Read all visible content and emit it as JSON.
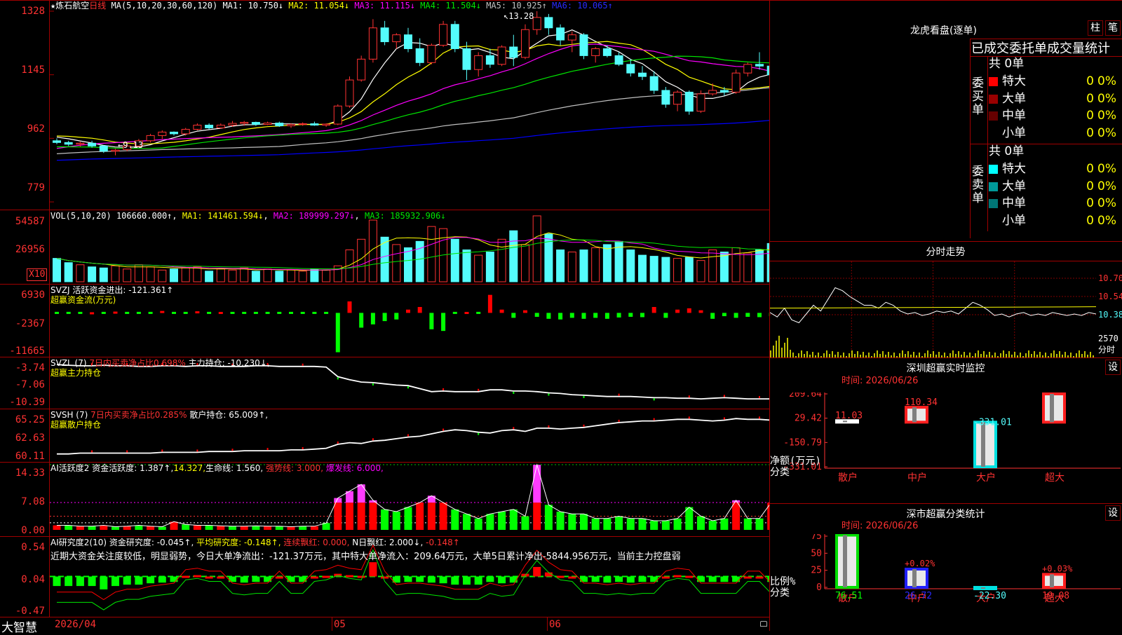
{
  "stock": {
    "star": "★",
    "name": "炼石航空",
    "period": "日线",
    "bottom_brand": "大智慧",
    "date_start": "2026/04",
    "month_05": "05",
    "month_06": "06"
  },
  "main_chart": {
    "axis_ticks": [
      "1328",
      "1145",
      "962",
      "779"
    ],
    "ma_legend": {
      "prefix": "MA(5,10,20,30,60,120)",
      "ma1": "MA1: 10.750↓",
      "ma2": "MA2: 11.054↓",
      "ma3": "MA3: 11.115↓",
      "ma4": "MA4: 11.504↓",
      "ma5": "MA5: 10.925↑",
      "ma6": "MA6: 10.065↑"
    },
    "high_label": "13.28",
    "low_label": "9.13",
    "colors": {
      "up": "#ff3232",
      "down": "#54fcfc",
      "ma1": "#ffffff",
      "ma2": "#ffff00",
      "ma3": "#ff00ff",
      "ma4": "#00e600",
      "ma5": "#c0c0c0",
      "ma6": "#0000ff"
    }
  },
  "vol_panel": {
    "axis_ticks": [
      "54587",
      "26956"
    ],
    "unit_label": "X10",
    "legend": {
      "prefix": "VOL(5,10,20)",
      "value": "106660.000↑",
      "ma1": "MA1: 141461.594↓",
      "ma2": "MA2: 189999.297↓",
      "ma3": "MA3: 185932.906↓"
    }
  },
  "svzj_panel": {
    "axis_ticks": [
      "6930",
      "-2367",
      "-11665"
    ],
    "legend_line1": "SVZJ  活跃资金进出: -121.361↑",
    "legend_line2": "超赢资金流(万元)"
  },
  "svzl_panel": {
    "axis_ticks": [
      "-3.74",
      "-7.06",
      "-10.39"
    ],
    "legend_a": "SVZL (7)",
    "legend_b": "7日内买卖净占比0.698%",
    "legend_c": "主力持仓: -10.230↓,",
    "legend_line2": "超赢主力持仓"
  },
  "svsh_panel": {
    "axis_ticks": [
      "65.25",
      "62.63",
      "60.11"
    ],
    "legend_a": "SVSH (7)",
    "legend_b": "7日内买卖净占比0.285%",
    "legend_c": "散户持仓: 65.009↑,",
    "legend_line2": "超赢散户持仓"
  },
  "ai_active_panel": {
    "axis_ticks": [
      "14.33",
      "7.08",
      "0.00"
    ],
    "legend_a": "AI活跃度2",
    "legend_b": "资金活跃度: 1.387↑,",
    "legend_c": "14.327,",
    "legend_d": "生命线: 1.560,",
    "legend_e": "强势线: 3.000,",
    "legend_f": "爆发线: 6.000,"
  },
  "ai_research_panel": {
    "axis_ticks": [
      "0.54",
      "0.04",
      "-0.47"
    ],
    "legend_a": "AI研究度2(10)",
    "legend_b": "资金研究度: -0.045↑,",
    "legend_c": "平均研究度: -0.148↑,",
    "legend_d": "连续飘红: 0.000,",
    "legend_e": "N日飘红: 2.000↓,",
    "legend_f": "-0.148↑",
    "comment": "近期大资金关注度较低，明显弱势，今日大单净流出：-121.37万元，其中特大单净流入：209.64万元，大单5日累计净出-5844.956万元，当前主力控盘弱"
  },
  "dragon_panel": {
    "title": "龙虎看盘(逐单)",
    "btn1": "柱",
    "btn2": "笔",
    "header": "已成交委托单成交量统计",
    "buy_side": "委买单",
    "sell_side": "委卖单",
    "buy_total": "共 0单",
    "sell_total": "共 0单",
    "buy_rows": [
      {
        "label": "特大",
        "value": "0",
        "pct": "0%",
        "color": "#ff0000"
      },
      {
        "label": "大单",
        "value": "0",
        "pct": "0%",
        "color": "#990000"
      },
      {
        "label": "中单",
        "value": "0",
        "pct": "0%",
        "color": "#660000"
      },
      {
        "label": "小单",
        "value": "0",
        "pct": "0%",
        "color": ""
      }
    ],
    "sell_rows": [
      {
        "label": "特大",
        "value": "0",
        "pct": "0%",
        "color": "#00ffff"
      },
      {
        "label": "大单",
        "value": "0",
        "pct": "0%",
        "color": "#009999"
      },
      {
        "label": "中单",
        "value": "0",
        "pct": "0%",
        "color": "#007777"
      },
      {
        "label": "小单",
        "value": "0",
        "pct": "0%",
        "color": ""
      }
    ]
  },
  "intraday": {
    "title": "分时走势",
    "axis_ticks": [
      "10.70",
      "10.54",
      "10.38",
      "2570"
    ],
    "corner_label": "分时"
  },
  "sz_monitor": {
    "title": "深圳超赢实时监控",
    "btn": "设",
    "time": "时间: 2026/06/26",
    "axis_ticks": [
      "209.64",
      "29.42",
      "-150.79",
      "-331.01"
    ],
    "y_title": "净额(万元)",
    "x_title": "分类",
    "bars": [
      {
        "cat": "散户",
        "value": 11.03,
        "label": "11.03"
      },
      {
        "cat": "中户",
        "value": 110.34,
        "label": "110.34"
      },
      {
        "cat": "大户",
        "value": -331.01,
        "label": "-331.01"
      },
      {
        "cat": "超大",
        "value": 209.64,
        "label": "209.64"
      }
    ]
  },
  "sz_stats": {
    "title": "深市超赢分类统计",
    "btn": "设",
    "time": "时间: 2026/06/26",
    "axis_ticks": [
      "75",
      "50",
      "25",
      "0"
    ],
    "y_title": "比例%",
    "x_title": "分类",
    "bars": [
      {
        "cat": "散户",
        "value": 76.51,
        "label": "76.51",
        "delta": "+0.00%"
      },
      {
        "cat": "中户",
        "value": 26.72,
        "label": "26.72",
        "delta": "+0.02%"
      },
      {
        "cat": "大户",
        "value": -22.3,
        "label": "-22.30",
        "delta": ""
      },
      {
        "cat": "超大",
        "value": 19.08,
        "label": "19.08",
        "delta": "+0.03%"
      }
    ]
  },
  "chart_data": [
    {
      "type": "candlestick",
      "title": "炼石航空 日线",
      "ylim": [
        7.79,
        13.28
      ],
      "ohlc": [
        [
          9.55,
          9.62,
          9.45,
          9.5
        ],
        [
          9.5,
          9.55,
          9.4,
          9.45
        ],
        [
          9.45,
          9.52,
          9.38,
          9.48
        ],
        [
          9.48,
          9.55,
          9.35,
          9.4
        ],
        [
          9.4,
          9.42,
          9.2,
          9.25
        ],
        [
          9.25,
          9.32,
          9.13,
          9.28
        ],
        [
          9.3,
          9.45,
          9.25,
          9.4
        ],
        [
          9.4,
          9.6,
          9.38,
          9.55
        ],
        [
          9.55,
          9.75,
          9.5,
          9.7
        ],
        [
          9.7,
          9.85,
          9.6,
          9.8
        ],
        [
          9.8,
          9.82,
          9.7,
          9.75
        ],
        [
          9.75,
          9.92,
          9.7,
          9.88
        ],
        [
          9.88,
          10.05,
          9.85,
          10.0
        ],
        [
          10.0,
          10.05,
          9.88,
          9.92
        ],
        [
          9.92,
          10.05,
          9.9,
          10.0
        ],
        [
          10.0,
          10.12,
          9.95,
          10.05
        ],
        [
          10.05,
          10.12,
          9.98,
          10.08
        ],
        [
          10.08,
          10.1,
          9.98,
          10.02
        ],
        [
          10.02,
          10.1,
          10.0,
          10.06
        ],
        [
          10.06,
          10.1,
          9.95,
          9.98
        ],
        [
          9.98,
          10.05,
          9.92,
          10.02
        ],
        [
          10.02,
          10.08,
          9.98,
          10.04
        ],
        [
          10.04,
          10.1,
          9.98,
          10.0
        ],
        [
          10.0,
          10.05,
          9.95,
          10.03
        ],
        [
          10.03,
          10.6,
          10.0,
          10.55
        ],
        [
          10.55,
          11.4,
          10.5,
          11.3
        ],
        [
          11.3,
          12.0,
          11.25,
          11.9
        ],
        [
          11.9,
          13.05,
          11.8,
          12.8
        ],
        [
          12.8,
          13.0,
          12.3,
          12.4
        ],
        [
          12.4,
          12.65,
          12.2,
          12.6
        ],
        [
          12.6,
          12.8,
          12.1,
          12.2
        ],
        [
          12.2,
          12.5,
          11.7,
          11.8
        ],
        [
          11.8,
          12.35,
          11.75,
          12.3
        ],
        [
          12.3,
          13.0,
          12.25,
          12.9
        ],
        [
          12.9,
          13.0,
          12.1,
          12.2
        ],
        [
          12.2,
          12.4,
          11.3,
          11.6
        ],
        [
          11.6,
          12.1,
          11.4,
          12.0
        ],
        [
          12.0,
          12.2,
          11.65,
          11.75
        ],
        [
          11.75,
          12.3,
          11.7,
          12.25
        ],
        [
          12.25,
          12.6,
          11.7,
          11.95
        ],
        [
          11.95,
          12.9,
          11.9,
          12.75
        ],
        [
          12.75,
          13.28,
          12.6,
          13.1
        ],
        [
          13.1,
          13.2,
          12.6,
          12.8
        ],
        [
          12.8,
          12.9,
          12.3,
          12.45
        ],
        [
          12.45,
          12.7,
          12.1,
          12.6
        ],
        [
          12.6,
          12.65,
          11.9,
          12.0
        ],
        [
          12.0,
          12.25,
          11.8,
          12.2
        ],
        [
          12.2,
          12.3,
          11.95,
          12.0
        ],
        [
          12.0,
          12.1,
          11.7,
          11.75
        ],
        [
          11.75,
          11.9,
          11.4,
          11.5
        ],
        [
          11.5,
          11.7,
          11.3,
          11.4
        ],
        [
          11.4,
          11.55,
          10.9,
          11.0
        ],
        [
          11.0,
          11.1,
          10.5,
          10.6
        ],
        [
          10.6,
          11.0,
          10.4,
          10.95
        ],
        [
          10.95,
          11.0,
          10.3,
          10.4
        ],
        [
          10.4,
          11.0,
          10.35,
          10.9
        ],
        [
          10.9,
          11.2,
          10.85,
          11.0
        ],
        [
          11.0,
          11.1,
          10.85,
          10.95
        ],
        [
          10.95,
          11.6,
          10.9,
          11.5
        ],
        [
          11.5,
          11.8,
          11.4,
          11.75
        ],
        [
          11.75,
          12.1,
          11.6,
          11.7
        ],
        [
          11.7,
          12.2,
          11.3,
          11.45
        ],
        [
          11.45,
          11.55,
          10.95,
          11.05
        ],
        [
          11.05,
          11.2,
          10.9,
          11.15
        ],
        [
          11.15,
          11.2,
          10.8,
          10.85
        ],
        [
          10.85,
          10.9,
          10.6,
          10.7
        ],
        [
          10.7,
          10.75,
          10.45,
          10.5
        ]
      ]
    },
    {
      "type": "bar",
      "title": "VOL(5,10,20)",
      "ylim": [
        0,
        60000
      ],
      "values": [
        22000,
        18000,
        16000,
        14000,
        13000,
        15000,
        12000,
        16000,
        14000,
        11000,
        12000,
        13000,
        14000,
        10000,
        12000,
        11000,
        13000,
        10000,
        12000,
        10000,
        11000,
        10000,
        12000,
        11000,
        15000,
        30000,
        40000,
        58000,
        42000,
        35000,
        32000,
        38000,
        52000,
        50000,
        40000,
        30000,
        25000,
        28000,
        40000,
        48000,
        35000,
        62000,
        45000,
        30000,
        28000,
        30000,
        32000,
        35000,
        38000,
        30000,
        25000,
        24000,
        23000,
        22000,
        23000,
        20000,
        30000,
        28000,
        32000,
        27000,
        30000,
        36000,
        40000,
        30000,
        28000,
        25000,
        23000
      ]
    },
    {
      "type": "bar",
      "title": "超赢资金流(万元)",
      "ylim": [
        -11665,
        6930
      ],
      "values": [
        0,
        0,
        0,
        200,
        0,
        400,
        0,
        0,
        0,
        600,
        0,
        0,
        500,
        0,
        300,
        0,
        0,
        0,
        0,
        0,
        0,
        0,
        0,
        0,
        -12000,
        3500,
        -4500,
        -3500,
        -2500,
        -2000,
        1000,
        1800,
        -5000,
        -5500,
        0,
        300,
        0,
        5500,
        1000,
        -1500,
        800,
        -1200,
        -1800,
        -2000,
        -1500,
        -1800,
        -1500,
        -1800,
        -1400,
        -1200,
        -1300,
        1800,
        -1500,
        1000,
        1400,
        800,
        -1800,
        -1000,
        -1500,
        -1200,
        -1300,
        -1000,
        -1200,
        -1000,
        -800,
        -900,
        -900
      ]
    },
    {
      "type": "line",
      "title": "超赢主力持仓",
      "ylim": [
        -10.39,
        -3.74
      ],
      "values": [
        -4.0,
        -4.1,
        -4.2,
        -4.2,
        -4.1,
        -4.2,
        -4.2,
        -4.3,
        -4.3,
        -4.2,
        -4.2,
        -4.3,
        -4.2,
        -4.2,
        -4.3,
        -4.3,
        -4.3,
        -4.2,
        -4.2,
        -4.3,
        -4.3,
        -4.3,
        -4.3,
        -4.4,
        -6.0,
        -6.5,
        -6.9,
        -7.0,
        -7.2,
        -7.4,
        -7.5,
        -8.0,
        -8.5,
        -8.4,
        -8.5,
        -8.5,
        -8.5,
        -8.2,
        -8.2,
        -8.4,
        -8.4,
        -8.5,
        -8.7,
        -8.8,
        -9.0,
        -9.1,
        -9.2,
        -9.3,
        -9.3,
        -9.3,
        -9.4,
        -9.5,
        -9.5,
        -9.6,
        -9.6,
        -9.7,
        -9.6,
        -9.5,
        -9.6,
        -9.7,
        -9.7,
        -9.7,
        -9.9,
        -10.0,
        -10.2,
        -10.2,
        -10.23
      ]
    },
    {
      "type": "line",
      "title": "超赢散户持仓",
      "ylim": [
        60.11,
        65.25
      ],
      "values": [
        60.4,
        60.4,
        60.5,
        60.5,
        60.5,
        60.5,
        60.5,
        60.5,
        60.5,
        60.6,
        60.6,
        60.6,
        60.6,
        60.7,
        60.7,
        60.7,
        60.8,
        60.8,
        60.8,
        60.8,
        60.9,
        60.9,
        61.0,
        61.1,
        61.6,
        61.8,
        61.7,
        62.0,
        62.1,
        62.3,
        62.5,
        62.6,
        62.9,
        63.2,
        63.4,
        63.3,
        63.1,
        63.0,
        63.3,
        63.4,
        63.2,
        63.6,
        63.6,
        63.5,
        63.6,
        63.7,
        63.9,
        64.1,
        64.3,
        64.4,
        64.5,
        64.5,
        64.6,
        64.7,
        64.7,
        64.6,
        64.5,
        64.6,
        64.8,
        64.7,
        64.7,
        64.6,
        64.6,
        64.7,
        64.8,
        64.9,
        65.0
      ]
    },
    {
      "type": "bar",
      "title": "AI活跃度2",
      "ylim": [
        0,
        14.33
      ],
      "lines": {
        "生命线": 1.56,
        "强势线": 3.0,
        "爆发线": 6.0
      },
      "values": [
        1.0,
        1.0,
        0.8,
        0.8,
        1.0,
        0.7,
        0.8,
        1.0,
        0.8,
        0.7,
        1.8,
        1.2,
        1.0,
        1.0,
        0.9,
        0.8,
        0.8,
        0.9,
        0.8,
        0.8,
        0.7,
        0.8,
        0.8,
        1.5,
        7.0,
        8.5,
        10.0,
        6.5,
        4.5,
        4.0,
        5.0,
        6.0,
        7.5,
        6.0,
        4.5,
        3.5,
        2.5,
        3.5,
        4.0,
        4.5,
        3.0,
        14.3,
        5.5,
        4.0,
        3.5,
        3.5,
        2.5,
        2.5,
        3.0,
        2.5,
        2.5,
        2.0,
        2.0,
        2.5,
        5.0,
        3.0,
        2.0,
        2.5,
        6.5,
        2.5,
        2.5,
        6.0,
        4.0,
        1.8,
        1.8,
        1.5,
        1.4
      ]
    },
    {
      "type": "bar",
      "title": "AI研究度2(10)",
      "ylim": [
        -0.47,
        0.54
      ],
      "values": [
        -0.1,
        -0.1,
        -0.1,
        -0.1,
        -0.15,
        -0.1,
        -0.08,
        -0.08,
        -0.06,
        -0.05,
        -0.04,
        0.05,
        0.06,
        0.04,
        0.04,
        -0.04,
        -0.05,
        -0.04,
        -0.04,
        0.04,
        -0.04,
        -0.04,
        0.04,
        0.05,
        0.08,
        0.06,
        0.05,
        0.25,
        0.04,
        -0.05,
        -0.04,
        -0.04,
        -0.05,
        -0.06,
        -0.08,
        -0.08,
        -0.08,
        -0.04,
        -0.06,
        -0.05,
        0.08,
        0.18,
        0.1,
        0.05,
        0.04,
        -0.04,
        -0.04,
        -0.05,
        -0.04,
        -0.05,
        -0.04,
        -0.04,
        0.04,
        0.06,
        0.05,
        -0.04,
        -0.04,
        -0.04,
        -0.04,
        0.04,
        0.04,
        -0.04,
        -0.05,
        -0.06,
        -0.05,
        -0.05,
        -0.05
      ]
    },
    {
      "type": "line",
      "title": "分时走势",
      "ylim": [
        10.22,
        10.7
      ],
      "avg_price": 10.38,
      "values": [
        10.35,
        10.32,
        10.38,
        10.3,
        10.28,
        10.34,
        10.4,
        10.36,
        10.44,
        10.52,
        10.5,
        10.46,
        10.43,
        10.4,
        10.4,
        10.38,
        10.42,
        10.4,
        10.36,
        10.34,
        10.35,
        10.33,
        10.34,
        10.36,
        10.35,
        10.36,
        10.34,
        10.38,
        10.42,
        10.4,
        10.37,
        10.33,
        10.34,
        10.32,
        10.34,
        10.35,
        10.33,
        10.34,
        10.33,
        10.35,
        10.34,
        10.33,
        10.34,
        10.33,
        10.35,
        10.34
      ]
    }
  ]
}
